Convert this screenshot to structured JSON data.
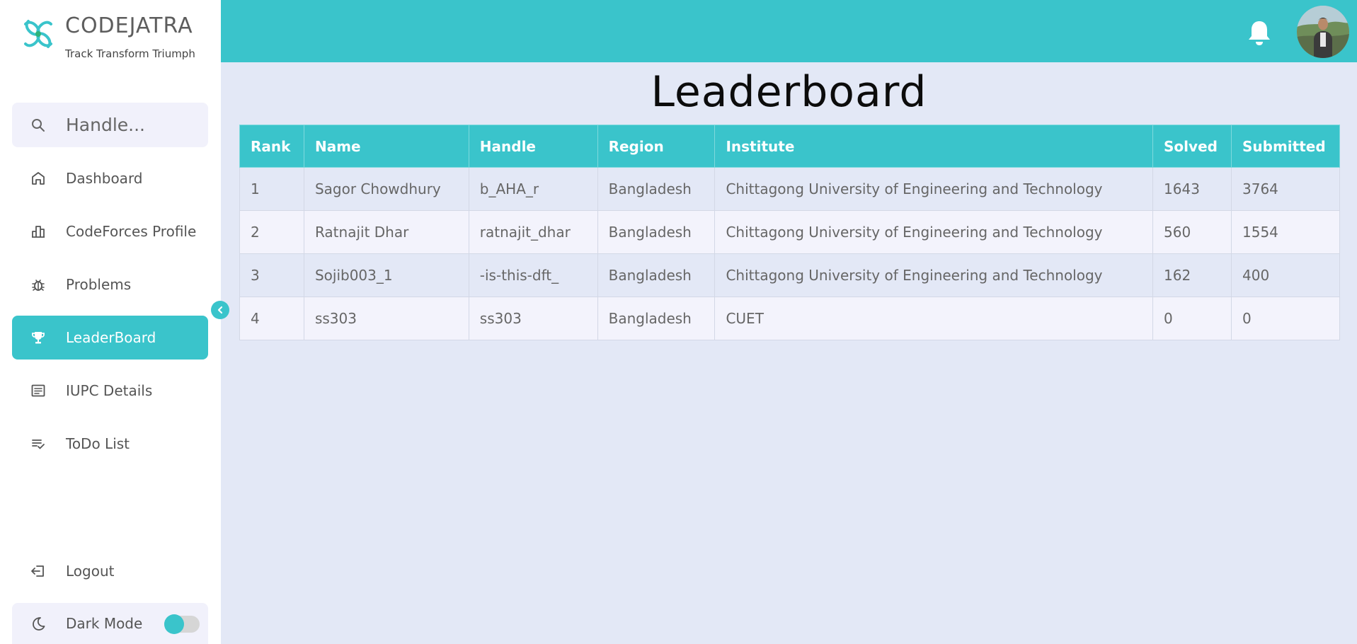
{
  "brand": {
    "name": "CODEJATRA",
    "tagline": "Track Transform Triumph"
  },
  "search": {
    "placeholder": "Handle..."
  },
  "sidebar": {
    "items": [
      {
        "label": "Dashboard",
        "icon": "home-icon"
      },
      {
        "label": "CodeForces Profile",
        "icon": "bar-chart-icon"
      },
      {
        "label": "Problems",
        "icon": "bug-icon"
      },
      {
        "label": "LeaderBoard",
        "icon": "trophy-icon",
        "active": true
      },
      {
        "label": "IUPC Details",
        "icon": "document-icon"
      },
      {
        "label": "ToDo List",
        "icon": "checklist-icon"
      }
    ],
    "logout_label": "Logout",
    "dark_mode_label": "Dark Mode"
  },
  "header": {
    "notification_icon": "bell-icon"
  },
  "page": {
    "title": "Leaderboard"
  },
  "table": {
    "columns": [
      "Rank",
      "Name",
      "Handle",
      "Region",
      "Institute",
      "Solved",
      "Submitted"
    ],
    "rows": [
      [
        "1",
        "Sagor Chowdhury",
        "b_AHA_r",
        "Bangladesh",
        "Chittagong University of Engineering and Technology",
        "1643",
        "3764"
      ],
      [
        "2",
        "Ratnajit Dhar",
        "ratnajit_dhar",
        "Bangladesh",
        "Chittagong University of Engineering and Technology",
        "560",
        "1554"
      ],
      [
        "3",
        "Sojib003_1",
        "-is-this-dft_",
        "Bangladesh",
        "Chittagong University of Engineering and Technology",
        "162",
        "400"
      ],
      [
        "4",
        "ss303",
        "ss303",
        "Bangladesh",
        "CUET",
        "0",
        "0"
      ]
    ]
  },
  "colors": {
    "accent": "#3ac4cb",
    "background": "#e3e8f6",
    "sidebar": "#ffffff"
  }
}
